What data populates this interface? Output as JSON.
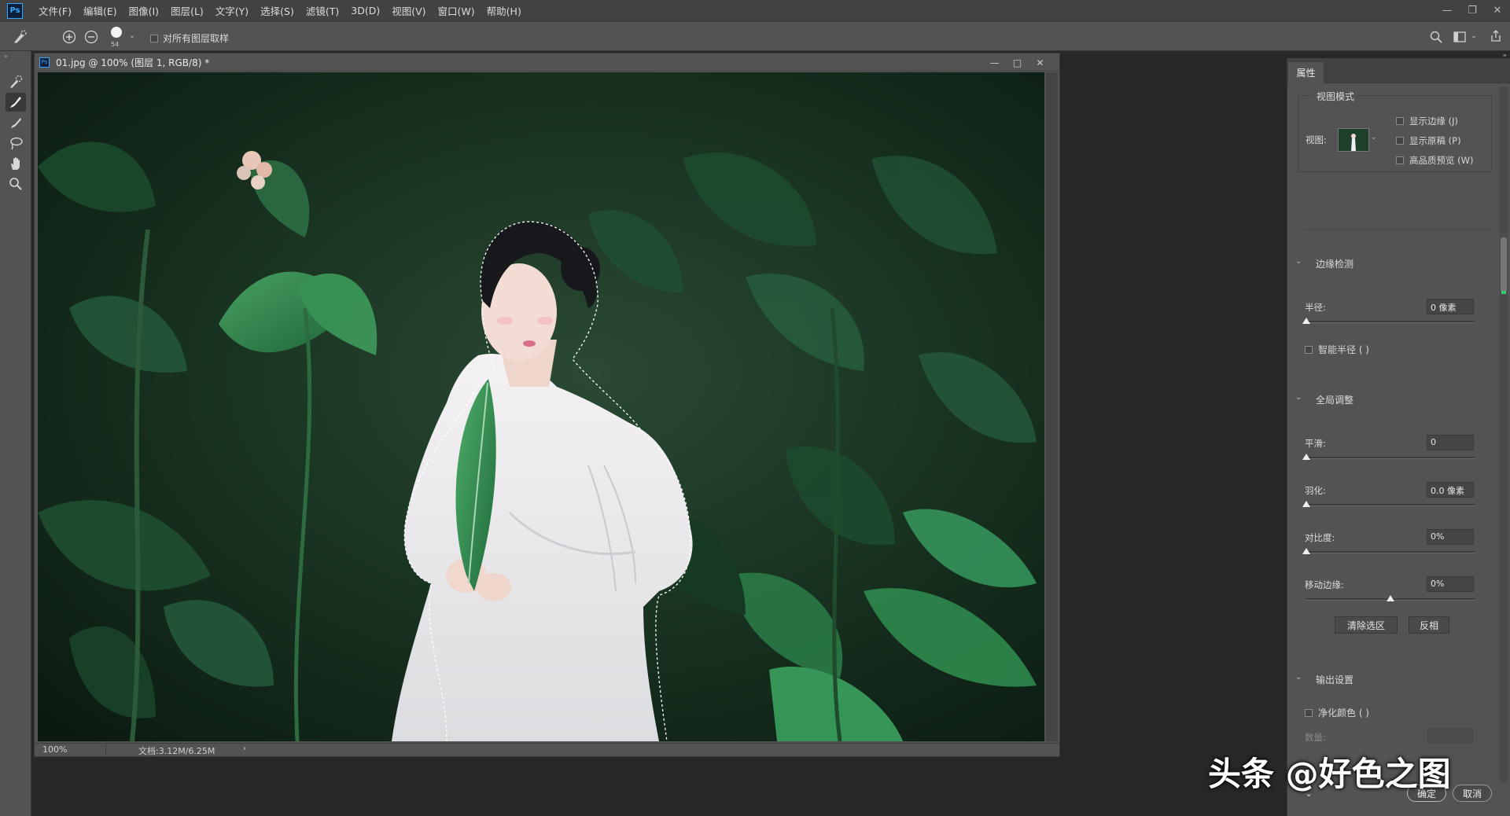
{
  "app": {
    "logo": "Ps"
  },
  "menu": [
    "文件(F)",
    "编辑(E)",
    "图像(I)",
    "图层(L)",
    "文字(Y)",
    "选择(S)",
    "滤镜(T)",
    "3D(D)",
    "视图(V)",
    "窗口(W)",
    "帮助(H)"
  ],
  "options": {
    "brush_size": "54",
    "sample_all_layers": "对所有图层取样"
  },
  "document": {
    "title": "01.jpg @ 100% (图层 1, RGB/8) *",
    "zoom": "100%",
    "doc_size": "文档:3.12M/6.25M"
  },
  "panel": {
    "tab": "属性",
    "view_mode": {
      "heading": "视图模式",
      "view_label": "视图:",
      "show_edge": "显示边缘 (J)",
      "show_original": "显示原稿 (P)",
      "hq_preview": "高品质预览 (W)"
    },
    "edge_detection": {
      "heading": "边缘检测",
      "radius_label": "半径:",
      "radius_value": "0 像素",
      "radius_pct": 0,
      "smart_radius": "智能半径 ( )"
    },
    "global_adjust": {
      "heading": "全局调整",
      "smooth_label": "平滑:",
      "smooth_value": "0",
      "smooth_pct": 0,
      "feather_label": "羽化:",
      "feather_value": "0.0 像素",
      "feather_pct": 0,
      "contrast_label": "对比度:",
      "contrast_value": "0%",
      "contrast_pct": 0,
      "shift_label": "移动边缘:",
      "shift_value": "0%",
      "shift_pct": 50,
      "clear_button": "清除选区",
      "invert_button": "反相"
    },
    "output": {
      "heading": "输出设置",
      "decontaminate": "净化颜色 ( )",
      "amount_label": "数量:"
    },
    "ok_button": "确定",
    "cancel_button": "取消"
  },
  "watermark": "头条 @好色之图"
}
